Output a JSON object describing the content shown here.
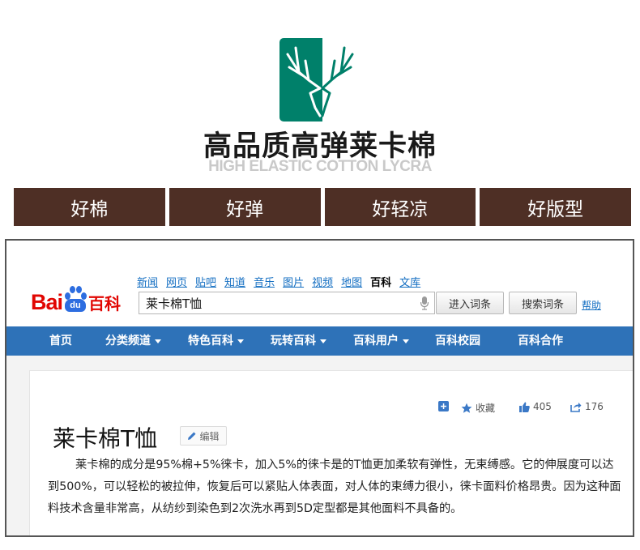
{
  "banner": {
    "logo_icon": "deer-antler-logo-icon",
    "logo_colors": {
      "left": "#00806a",
      "right": "#ffffff",
      "line": "#ffffff",
      "line_on_light": "#00806a"
    },
    "title": "高品质高弹莱卡棉",
    "subtitle": "HIGH ELASTIC COTTON LYCRA",
    "features": [
      "好棉",
      "好弹",
      "好轻凉",
      "好版型"
    ],
    "feature_color": "#4e2f25"
  },
  "baike": {
    "logo": {
      "bai": "Bai",
      "du": "du",
      "baike": "百科"
    },
    "nav": [
      "新闻",
      "网页",
      "贴吧",
      "知道",
      "音乐",
      "图片",
      "视频",
      "地图",
      "百科",
      "文库"
    ],
    "nav_active": "百科",
    "search": {
      "value": "莱卡棉T恤"
    },
    "enter_button": "进入词条",
    "search_button": "搜索词条",
    "help": "帮助",
    "menu": [
      {
        "label": "首页",
        "dropdown": false
      },
      {
        "label": "分类频道",
        "dropdown": true
      },
      {
        "label": "特色百科",
        "dropdown": true
      },
      {
        "label": "玩转百科",
        "dropdown": true
      },
      {
        "label": "百科用户",
        "dropdown": true
      },
      {
        "label": "百科校园",
        "dropdown": false
      },
      {
        "label": "百科合作",
        "dropdown": false
      }
    ],
    "menu_color": "#2e72b8",
    "tools": {
      "collect": "收藏",
      "likes": "405",
      "shares": "176"
    },
    "entry": {
      "title": "莱卡棉T恤",
      "edit": "编辑",
      "text": "莱卡棉的成分是95%棉+5%徕卡，加入5%的徕卡是的T恤更加柔软有弹性，无束缚感。它的伸展度可以达到500%，可以轻松的被拉伸，恢复后可以紧贴人体表面，对人体的束缚力很小，徕卡面料价格昂贵。因为这种面料技术含量非常高，从纺纱到染色到2次洗水再到5D定型都是其他面料不具备的。"
    }
  }
}
